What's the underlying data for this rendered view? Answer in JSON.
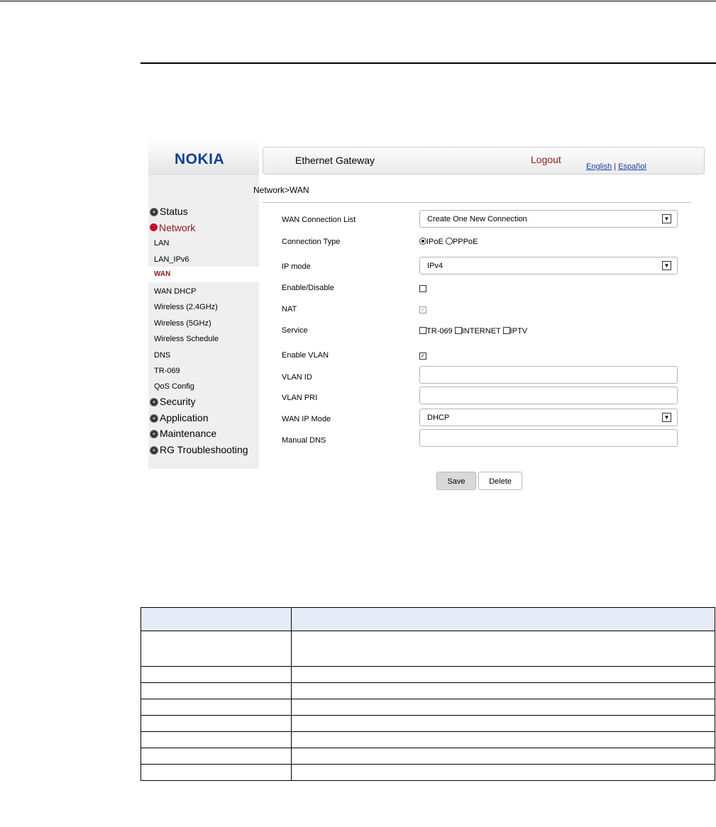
{
  "brand": {
    "logo": "NOKIA",
    "logo_color": "#124191"
  },
  "header": {
    "title": "Ethernet Gateway",
    "logout": "Logout",
    "lang_english": "English",
    "lang_sep": "|",
    "lang_spanish": "Español"
  },
  "sidebar": {
    "status": "Status",
    "network": "Network",
    "lan": "LAN",
    "lan_ipv6": "LAN_IPv6",
    "wan": "WAN",
    "wan_dhcp": "WAN DHCP",
    "wireless_24": "Wireless (2.4GHz)",
    "wireless_5": "Wireless (5GHz)",
    "wireless_schedule": "Wireless Schedule",
    "dns": "DNS",
    "tr069": "TR-069",
    "qos": "QoS Config",
    "security": "Security",
    "application": "Application",
    "maintenance": "Maintenance",
    "rg_troubleshooting": "RG Troubleshooting"
  },
  "breadcrumb": "Network>WAN",
  "form": {
    "wan_connection_list": {
      "label": "WAN Connection List",
      "value": "Create One New Connection"
    },
    "connection_type": {
      "label": "Connection Type",
      "opt_ipoe": "IPoE",
      "opt_pppoe": "PPPoE",
      "selected": "IPoE"
    },
    "ip_mode": {
      "label": "IP mode",
      "value": "IPv4"
    },
    "enable_disable": {
      "label": "Enable/Disable",
      "checked": false
    },
    "nat": {
      "label": "NAT",
      "checked": true,
      "disabled": true
    },
    "service": {
      "label": "Service",
      "opt_tr069": "TR-069",
      "opt_internet": "INTERNET",
      "opt_iptv": "IPTV"
    },
    "enable_vlan": {
      "label": "Enable VLAN",
      "checked": true
    },
    "vlan_id": {
      "label": "VLAN ID",
      "value": ""
    },
    "vlan_pri": {
      "label": "VLAN PRI",
      "value": ""
    },
    "wan_ip_mode": {
      "label": "WAN IP Mode",
      "value": "DHCP"
    },
    "manual_dns": {
      "label": "Manual DNS",
      "value": ""
    }
  },
  "buttons": {
    "save": "Save",
    "delete": "Delete"
  },
  "table": {
    "headers": [
      "",
      ""
    ],
    "rows": [
      [
        "",
        ""
      ],
      [
        "",
        ""
      ],
      [
        "",
        ""
      ],
      [
        "",
        ""
      ],
      [
        "",
        ""
      ],
      [
        "",
        ""
      ],
      [
        "",
        ""
      ],
      [
        "",
        ""
      ]
    ]
  }
}
